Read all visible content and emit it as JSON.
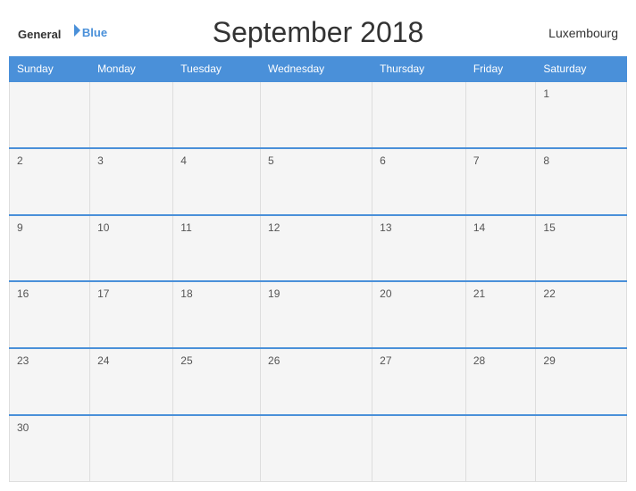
{
  "header": {
    "logo_general": "General",
    "logo_blue": "Blue",
    "title": "September 2018",
    "country": "Luxembourg"
  },
  "days": {
    "headers": [
      "Sunday",
      "Monday",
      "Tuesday",
      "Wednesday",
      "Thursday",
      "Friday",
      "Saturday"
    ]
  },
  "weeks": [
    [
      "",
      "",
      "",
      "",
      "",
      "",
      "1"
    ],
    [
      "2",
      "3",
      "4",
      "5",
      "6",
      "7",
      "8"
    ],
    [
      "9",
      "10",
      "11",
      "12",
      "13",
      "14",
      "15"
    ],
    [
      "16",
      "17",
      "18",
      "19",
      "20",
      "21",
      "22"
    ],
    [
      "23",
      "24",
      "25",
      "26",
      "27",
      "28",
      "29"
    ],
    [
      "30",
      "",
      "",
      "",
      "",
      "",
      ""
    ]
  ]
}
